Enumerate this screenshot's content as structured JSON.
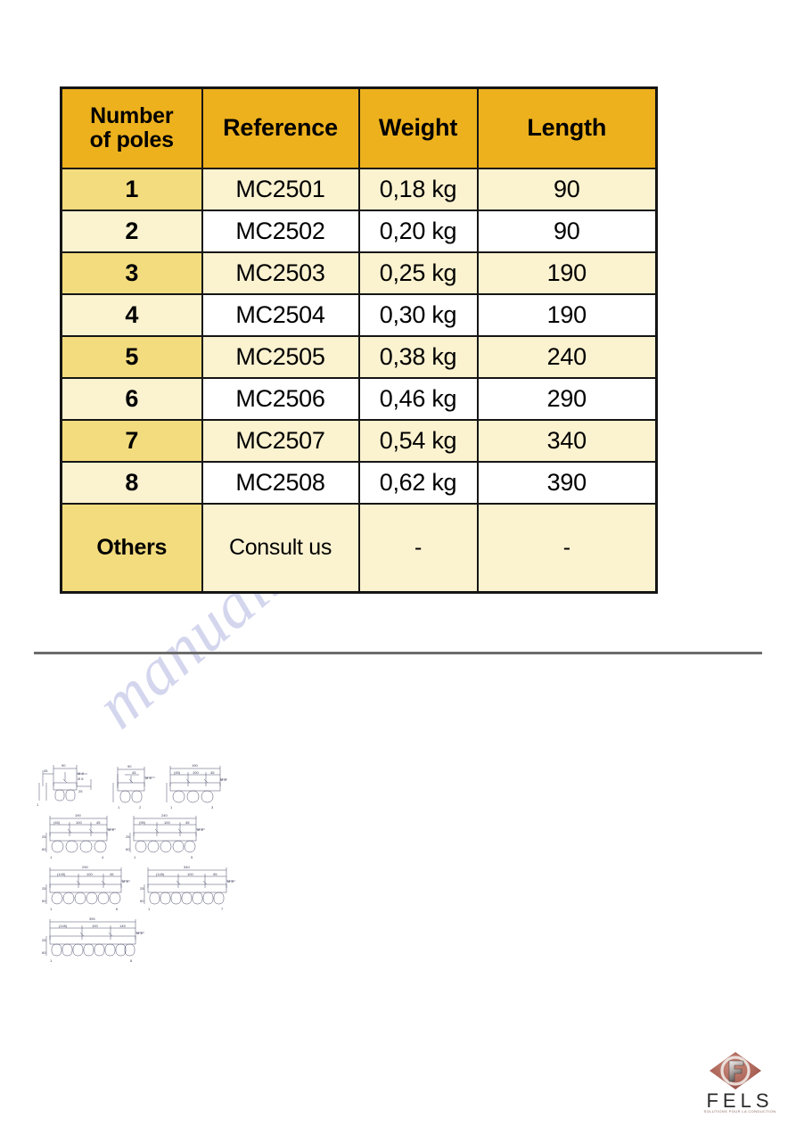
{
  "watermark": {
    "text": "manualshive.com"
  },
  "table": {
    "columns": [
      {
        "key": "poles",
        "label": "Number\nof poles",
        "label_line1": "Number",
        "label_line2": "of poles"
      },
      {
        "key": "ref",
        "label": "Reference"
      },
      {
        "key": "weight",
        "label": "Weight"
      },
      {
        "key": "length",
        "label": "Length"
      }
    ],
    "headers": {
      "poles_line1": "Number",
      "poles_line2": "of poles",
      "reference": "Reference",
      "weight": "Weight",
      "length": "Length"
    },
    "rows": [
      {
        "poles": "1",
        "reference": "MC2501",
        "weight": "0,18 kg",
        "length": "90",
        "shade": "odd"
      },
      {
        "poles": "2",
        "reference": "MC2502",
        "weight": "0,20 kg",
        "length": "90",
        "shade": "even"
      },
      {
        "poles": "3",
        "reference": "MC2503",
        "weight": "0,25 kg",
        "length": "190",
        "shade": "odd"
      },
      {
        "poles": "4",
        "reference": "MC2504",
        "weight": "0,30 kg",
        "length": "190",
        "shade": "even"
      },
      {
        "poles": "5",
        "reference": "MC2505",
        "weight": "0,38 kg",
        "length": "240",
        "shade": "odd"
      },
      {
        "poles": "6",
        "reference": "MC2506",
        "weight": "0,46 kg",
        "length": "290",
        "shade": "even"
      },
      {
        "poles": "7",
        "reference": "MC2507",
        "weight": "0,54 kg",
        "length": "340",
        "shade": "odd"
      },
      {
        "poles": "8",
        "reference": "MC2508",
        "weight": "0,62 kg",
        "length": "390",
        "shade": "even"
      },
      {
        "poles": "Others",
        "reference": "Consult us",
        "weight": "-",
        "length": "-",
        "shade": "others"
      }
    ]
  },
  "drawings": [
    {
      "poles": 1,
      "overall": "90",
      "dims": [
        "45",
        "90",
        "25",
        "M 8",
        "Ø 8",
        "25",
        "60"
      ],
      "start_label": "1",
      "end_label": "1"
    },
    {
      "poles": 2,
      "overall": "90",
      "dims": [
        "90",
        "45",
        "M 8",
        "25",
        "60"
      ],
      "start_label": "1",
      "end_label": "2"
    },
    {
      "poles": 3,
      "overall": "190",
      "dims": [
        "190",
        "(45)",
        "100",
        "45",
        "M 8",
        "25",
        "60"
      ],
      "start_label": "1",
      "end_label": "3"
    },
    {
      "poles": 4,
      "overall": "190",
      "dims": [
        "190",
        "(45)",
        "100",
        "45",
        "M 8",
        "25",
        "60"
      ],
      "start_label": "1",
      "end_label": "4"
    },
    {
      "poles": 5,
      "overall": "240",
      "dims": [
        "240",
        "(95)",
        "100",
        "45",
        "M 8",
        "25",
        "60"
      ],
      "start_label": "1",
      "end_label": "5"
    },
    {
      "poles": 6,
      "overall": "290",
      "dims": [
        "290",
        "(145)",
        "100",
        "45",
        "M 8",
        "25",
        "60"
      ],
      "start_label": "1",
      "end_label": "6"
    },
    {
      "poles": 7,
      "overall": "340",
      "dims": [
        "340",
        "(145)",
        "100",
        "95",
        "M 8",
        "25",
        "60"
      ],
      "start_label": "1",
      "end_label": "7"
    },
    {
      "poles": 8,
      "overall": "390",
      "dims": [
        "390",
        "(145)",
        "100",
        "145",
        "M 8",
        "25",
        "60"
      ],
      "start_label": "1",
      "end_label": "8"
    }
  ],
  "logo": {
    "word": "FELS",
    "tagline": "SOLUTIONS POUR LA CONDUCTION",
    "mark_color": "#b0685c",
    "letter": "F"
  },
  "colors": {
    "header_gold": "#edb11d",
    "row_yellow": "#f3dc7d",
    "row_cream": "#fbf2d0",
    "row_white": "#ffffff",
    "border": "#151515",
    "divider": "#6c6c6c",
    "watermark": "#9aa0d8"
  }
}
